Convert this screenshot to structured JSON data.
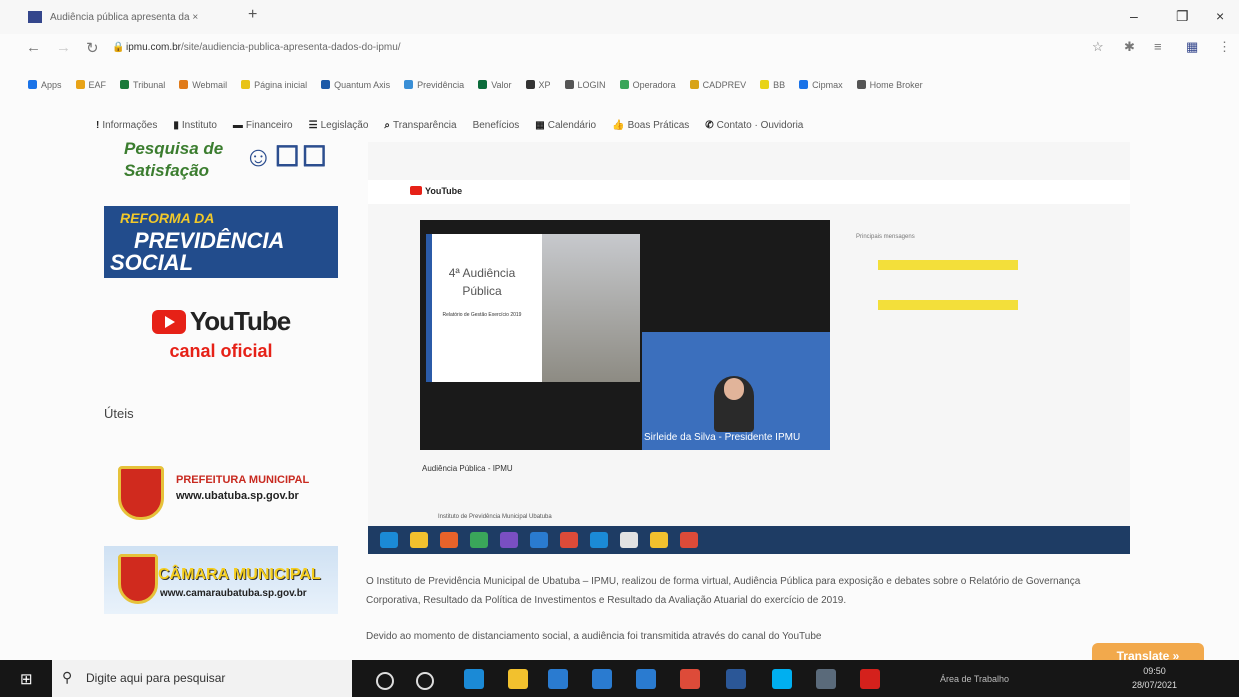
{
  "browser": {
    "tab_title": "Audiência pública apresenta da ×",
    "new_tab": "+",
    "url_domain": "ipmu.com.br",
    "url_path": "/site/audiencia-publica-apresenta-dados-do-ipmu/",
    "window_controls": [
      "–",
      "❐",
      "×"
    ],
    "bookmarks": [
      {
        "label": "Apps",
        "color": "#1a73e8"
      },
      {
        "label": "EAF",
        "color": "#e8a317"
      },
      {
        "label": "Tribunal",
        "color": "#1a7a3a"
      },
      {
        "label": "Webmail",
        "color": "#e07b1a"
      },
      {
        "label": "Página inicial",
        "color": "#e8c317"
      },
      {
        "label": "Quantum Axis",
        "color": "#1c5aa8"
      },
      {
        "label": "Previdência",
        "color": "#3a8fd6"
      },
      {
        "label": "Valor",
        "color": "#0b6b3a"
      },
      {
        "label": "XP",
        "color": "#333333"
      },
      {
        "label": "LOGIN",
        "color": "#555555"
      },
      {
        "label": "Operadora",
        "color": "#3aa65a"
      },
      {
        "label": "CADPREV",
        "color": "#d8a317"
      },
      {
        "label": "BB",
        "color": "#e8d317"
      },
      {
        "label": "Cipmax",
        "color": "#1a73e8"
      },
      {
        "label": "Home Broker",
        "color": "#555555"
      }
    ]
  },
  "site_nav": [
    {
      "icon": "!",
      "label": "Informações"
    },
    {
      "icon": "▮",
      "label": "Instituto"
    },
    {
      "icon": "▬",
      "label": "Financeiro"
    },
    {
      "icon": "☰",
      "label": "Legislação"
    },
    {
      "icon": "⌕",
      "label": "Transparência"
    },
    {
      "icon": "",
      "label": "Benefícios"
    },
    {
      "icon": "▦",
      "label": "Calendário"
    },
    {
      "icon": "👍",
      "label": "Boas Práticas"
    },
    {
      "icon": "✆",
      "label": "Contato · Ouvidoria"
    }
  ],
  "sidebar": {
    "pesquisa_line1": "Pesquisa de",
    "pesquisa_line2": "Satisfação",
    "reforma_line1": "REFORMA DA",
    "reforma_line2": "PREVIDÊNCIA",
    "reforma_line3": "SOCIAL",
    "youtube_logo": "YouTube",
    "youtube_caption": "canal oficial",
    "uteis": "Úteis",
    "prefeitura_name": "PREFEITURA MUNICIPAL",
    "prefeitura_url": "www.ubatuba.sp.gov.br",
    "camara_name": "CÂMARA MUNICIPAL",
    "camara_url": "www.camaraubatuba.sp.gov.br"
  },
  "embedded": {
    "yt_brand": "YouTube",
    "slide_title": "4ª Audiência Pública",
    "slide_subtitle": "Relatório de Gestão Exercício 2019",
    "caption": "Sirleide da Silva - Presidente IPMU",
    "video_title": "Audiência Pública - IPMU",
    "chat_header": "Principais mensagens",
    "channel": "Instituto de Previdência Municipal Ubatuba"
  },
  "article": {
    "paragraph1": "O Instituto de Previdência Municipal de Ubatuba – IPMU, realizou de forma virtual, Audiência Pública para exposição e debates sobre o Relatório de Governança Corporativa, Resultado da Política de Investimentos e Resultado da Avaliação Atuarial do exercício de 2019.",
    "paragraph2": "Devido ao momento de distanciamento social, a audiência foi transmitida através do canal do YouTube"
  },
  "translate_button": "Translate »",
  "taskbar": {
    "search_placeholder": "Digite aqui para pesquisar",
    "area": "Área de Trabalho",
    "time": "09:50",
    "date": "28/07/2021",
    "icons": [
      {
        "name": "cortana-icon",
        "color": "#161616"
      },
      {
        "name": "task-view-icon",
        "color": "#161616"
      },
      {
        "name": "edge-icon",
        "color": "#1b8ad6"
      },
      {
        "name": "file-explorer-icon",
        "color": "#f2c12e"
      },
      {
        "name": "store-icon",
        "color": "#2a7bd0"
      },
      {
        "name": "mail-icon",
        "color": "#2a7bd0"
      },
      {
        "name": "app-l-icon",
        "color": "#2a7bd0"
      },
      {
        "name": "chrome-icon",
        "color": "#dd4b39"
      },
      {
        "name": "word-icon",
        "color": "#2b5797"
      },
      {
        "name": "skype-icon",
        "color": "#00aff0"
      },
      {
        "name": "calculator-icon",
        "color": "#5a6a7a"
      },
      {
        "name": "acrobat-icon",
        "color": "#d4211c"
      }
    ]
  }
}
